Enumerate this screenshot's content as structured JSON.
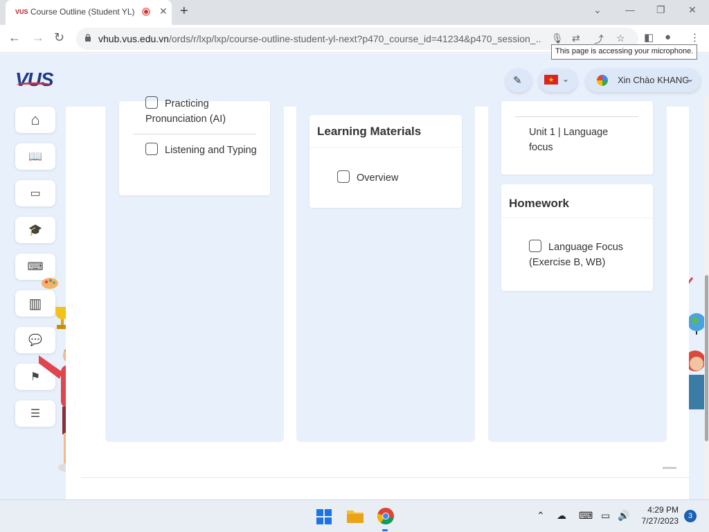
{
  "browser": {
    "tab_favicon": "VUS",
    "tab_title": "Course Outline (Student YL)",
    "tab_close": "✕",
    "new_tab": "+",
    "url_host": "vhub.vus.edu.vn",
    "url_path": "/ords/r/lxp/lxp/course-outline-student-yl-next?p470_course_id=41234&p470_session_...",
    "tooltip": "This page is accessing your microphone."
  },
  "header": {
    "logo": "VUS",
    "language_flag": "🇻🇳",
    "greeting": "Xin Chào KHANG"
  },
  "sidebar": {
    "items": [
      {
        "icon": "home-icon",
        "glyph": "⌂"
      },
      {
        "icon": "book-icon",
        "glyph": "📖"
      },
      {
        "icon": "image-icon",
        "glyph": "▭"
      },
      {
        "icon": "graduation-icon",
        "glyph": "🎓"
      },
      {
        "icon": "keyboard-icon",
        "glyph": "⌨"
      },
      {
        "icon": "library-icon",
        "glyph": "▥"
      },
      {
        "icon": "chat-icon",
        "glyph": "💬"
      },
      {
        "icon": "flag-icon",
        "glyph": "⚑"
      },
      {
        "icon": "checklist-icon",
        "glyph": "☰"
      }
    ]
  },
  "columns": {
    "col1": {
      "items": [
        "Practicing Pronunciation (AI)",
        "Listening and Typing"
      ]
    },
    "col2": {
      "card_title": "Learning Materials",
      "items": [
        "Overview"
      ]
    },
    "col3": {
      "unit_item": "Unit 1 | Language focus",
      "homework_title": "Homework",
      "homework_items": [
        "Language Focus (Exercise B, WB)"
      ]
    }
  },
  "taskbar": {
    "time": "4:29 PM",
    "date": "7/27/2023",
    "notification_count": "3"
  },
  "colors": {
    "brand_blue": "#1d3a8a",
    "brand_red": "#d62f3a",
    "app_bg": "#e8f0fb"
  }
}
